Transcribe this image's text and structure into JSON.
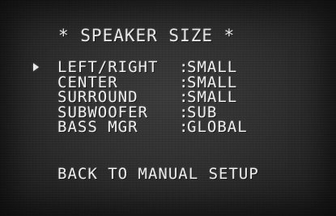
{
  "screen": {
    "title": "* SPEAKER SIZE *",
    "separator": ":",
    "cursor_icon": "right-triangle-cursor-icon",
    "items": [
      {
        "label": "LEFT/RIGHT",
        "value": "SMALL"
      },
      {
        "label": "CENTER",
        "value": "SMALL"
      },
      {
        "label": "SURROUND",
        "value": "SMALL"
      },
      {
        "label": "SUBWOOFER",
        "value": "SUB"
      },
      {
        "label": "BASS MGR",
        "value": "GLOBAL"
      }
    ],
    "back_label": "BACK TO MANUAL SETUP"
  }
}
